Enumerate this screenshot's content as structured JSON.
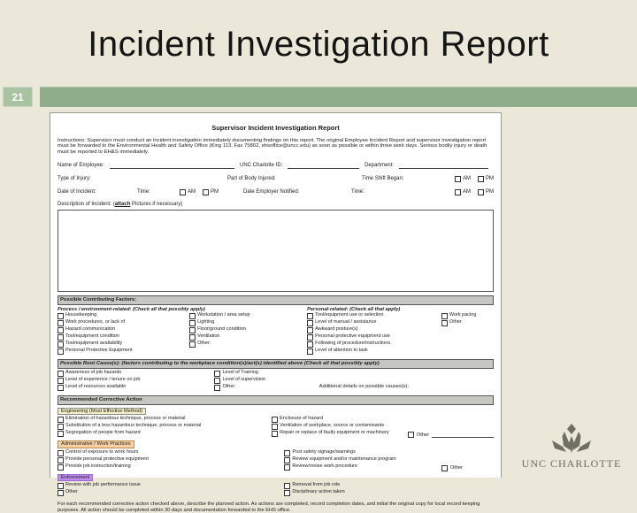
{
  "slide": {
    "title": "Incident Investigation Report",
    "slide_number": "21"
  },
  "logo": {
    "text": "UNC CHARLOTTE"
  },
  "colors": {
    "slide_bg": "#ebe8da",
    "band_green": "#8fad8a",
    "band_number_bg": "#a9c2a2",
    "section_bar_gray": "#c6c6c3",
    "highlight_engineering": "#f3eec6",
    "highlight_admin": "#f8d0a5",
    "highlight_enforcement": "#c18ff0",
    "logo_gray": "#6f6f64"
  },
  "form": {
    "title": "Supervisor Incident Investigation Report",
    "instructions": "Instructions: Supervisor must conduct an incident investigation immediately documenting findings on this report. The original Employee Incident Report and supervisor investigation report must be forwarded to the Environmental Health and Safety Office (King 113, Fax 75802, ehsoffice@uncc.edu) as soon as possible or within three work days. Serious bodily injury or death must be reported to EH&S immediately.",
    "fields": {
      "name_label": "Name of Employee:",
      "id_label": "UNC Charlotte ID:",
      "department_label": "Department:",
      "injury_label": "Type of Injury:",
      "body_label": "Part of Body Injured:",
      "shift_label": "Time Shift Began:",
      "am": "AM",
      "pm": "PM",
      "date_label": "Date of Incident:",
      "time_label": "Time:",
      "notified_label": "Date Employer Notified:",
      "time2_label": "Time:",
      "description_label_pre": "Description of Incident: (",
      "description_label_attach": "attach",
      "description_label_post": " Pictures if necessary)"
    },
    "contributing": {
      "header": "Possible Contributing Factors:",
      "process_header": "Process / environment-related: (Check all that possibly apply)",
      "process_col1": [
        "Housekeeping",
        "Work procedures, or lack of",
        "Hazard communication",
        "Tool/equipment condition",
        "Tool/equipment availability",
        "Personal Protective Equipment"
      ],
      "process_col2": [
        "Workstation / area setup",
        "Lighting",
        "Floor/ground condition",
        "Ventilation",
        "Other:"
      ],
      "personal_header": "Personal-related: (Check all that apply)",
      "personal_col1": [
        "Tool/equipment use or selection",
        "Level of manual / assistance",
        "Awkward posture(s)",
        "Personal protective equipment use",
        "Following of procedure/instructions",
        "Level of attention to task"
      ],
      "personal_col2": [
        "Work pacing",
        "Other"
      ]
    },
    "root_cause": {
      "header": "Possible Root Cause(s): (factors contributing to the workplace condition(s)/act(s) identified above (Check all that possibly apply)",
      "col1": [
        "Awareness of job hazards",
        "Level of experience / tenure on job",
        "Level of resources available"
      ],
      "col2": [
        "Level of Training",
        "Level of supervision",
        "Other"
      ],
      "details_label": "Additional details on possible causes(s):"
    },
    "corrective": {
      "header": "Recommended Corrective Action",
      "engineering_label": "Engineering (Most Effective Method)",
      "engineering_col1": [
        "Elimination of hazardous technique, process or material",
        "Substitution of a less hazardous technique, process or material",
        "Segregation of people from hazard"
      ],
      "engineering_col2": [
        "Enclosure of hazard",
        "Ventilation of workplace, source or contaminants",
        "Repair or replace of faulty equipment or machinery"
      ],
      "other_label": "Other",
      "admin_label": "Administrative / Work Practices",
      "admin_col1": [
        "Control of exposure to work hours",
        "Provide personal protective equipment",
        "Provide job instruction/training"
      ],
      "admin_col2": [
        "Post safety signage/warnings",
        "Review equipment and/or maintenance program",
        "Review/revise work procedure"
      ],
      "admin_other_label": "Other",
      "enforcement_label": "Enforcement",
      "enforcement_col1": [
        "Review with job performance issue",
        "Other"
      ],
      "enforcement_col2": [
        "Removal from job role",
        "Disciplinary action taken"
      ]
    },
    "footer": "For each recommended corrective action checked above, describe the planned action. As actions are completed, record completion dates, and initial the original copy for local record keeping purposes. All action should be completed within 30 days and documentation forwarded to the EHS office."
  }
}
